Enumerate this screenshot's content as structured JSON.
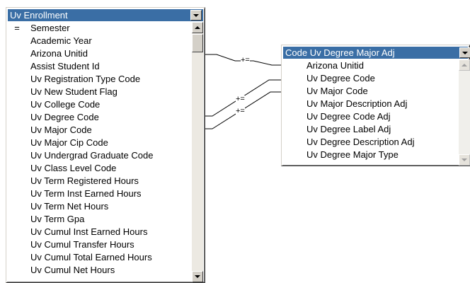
{
  "left_table": {
    "title": "Uv Enrollment",
    "fields": [
      {
        "mark": "=",
        "label": "Semester"
      },
      {
        "mark": "",
        "label": "Academic Year"
      },
      {
        "mark": "",
        "label": "Arizona Unitid"
      },
      {
        "mark": "",
        "label": "Assist Student Id"
      },
      {
        "mark": "",
        "label": "Uv Registration Type Code"
      },
      {
        "mark": "",
        "label": "Uv New Student Flag"
      },
      {
        "mark": "",
        "label": "Uv College Code"
      },
      {
        "mark": "",
        "label": "Uv Degree Code"
      },
      {
        "mark": "",
        "label": "Uv Major Code"
      },
      {
        "mark": "",
        "label": "Uv Major Cip Code"
      },
      {
        "mark": "",
        "label": "Uv Undergrad Graduate Code"
      },
      {
        "mark": "",
        "label": "Uv Class Level Code"
      },
      {
        "mark": "",
        "label": "Uv Term Registered Hours"
      },
      {
        "mark": "",
        "label": "Uv Term Inst Earned Hours"
      },
      {
        "mark": "",
        "label": "Uv Term Net Hours"
      },
      {
        "mark": "",
        "label": "Uv Term Gpa"
      },
      {
        "mark": "",
        "label": "Uv Cumul Inst Earned Hours"
      },
      {
        "mark": "",
        "label": "Uv Cumul Transfer Hours"
      },
      {
        "mark": "",
        "label": "Uv Cumul Total Earned Hours"
      },
      {
        "mark": "",
        "label": "Uv Cumul Net Hours"
      }
    ]
  },
  "right_table": {
    "title": "Code Uv Degree Major Adj",
    "fields": [
      {
        "label": "Arizona Unitid"
      },
      {
        "label": "Uv Degree Code"
      },
      {
        "label": "Uv Major Code"
      },
      {
        "label": "Uv Major Description Adj"
      },
      {
        "label": "Uv Degree Code Adj"
      },
      {
        "label": "Uv Degree Label Adj"
      },
      {
        "label": "Uv Degree Description Adj"
      },
      {
        "label": "Uv Degree Major Type"
      }
    ]
  },
  "joins": [
    {
      "from": "Arizona Unitid",
      "to": "Arizona Unitid",
      "operator": "+="
    },
    {
      "from": "Uv Degree Code",
      "to": "Uv Degree Code",
      "operator": "+="
    },
    {
      "from": "Uv Major Code",
      "to": "Uv Major Code",
      "operator": "+="
    }
  ],
  "icons": {
    "dropdown": "chevron-down-icon",
    "scroll_up": "scroll-up-icon",
    "scroll_down": "scroll-down-icon"
  }
}
